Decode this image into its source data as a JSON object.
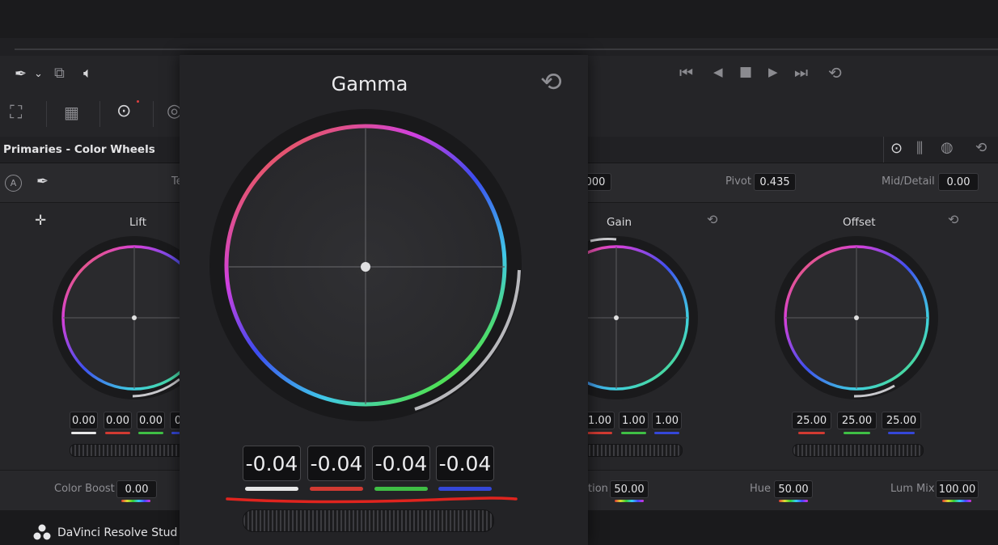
{
  "app": {
    "name": "DaVinci Resolve Stud"
  },
  "panel": {
    "title": "Primaries - Color Wheels"
  },
  "subrow": {
    "temp_label_partial": "Te",
    "contrast_partial": "000",
    "pivot_label": "Pivot",
    "pivot_value": "0.435",
    "middetail_label": "Mid/Detail",
    "middetail_value": "0.00"
  },
  "wheels": {
    "lift": {
      "label": "Lift",
      "values": [
        "0.00",
        "0.00",
        "0.00",
        "0"
      ]
    },
    "gain": {
      "label": "Gain",
      "values": [
        "1.00",
        "1.00",
        "1.00"
      ]
    },
    "offset": {
      "label": "Offset",
      "values": [
        "25.00",
        "25.00",
        "25.00"
      ]
    }
  },
  "bottom": {
    "color_boost_label": "Color Boost",
    "color_boost_value": "0.00",
    "saturation_label_partial": "tion",
    "saturation_value": "50.00",
    "hue_label": "Hue",
    "hue_value": "50.00",
    "lum_mix_label": "Lum Mix",
    "lum_mix_value": "100.00"
  },
  "gamma": {
    "title": "Gamma",
    "values": [
      "-0.04",
      "-0.04",
      "-0.04",
      "-0.04"
    ]
  },
  "colors": {
    "white": "#e8e8e8",
    "red": "#d13a32",
    "green": "#3fbf45",
    "blue": "#3447d8",
    "annotation": "#e0241e"
  },
  "icons": [
    "eyedropper-icon",
    "chevron-down-icon",
    "layers-icon",
    "speaker-icon",
    "skip-start-icon",
    "step-back-icon",
    "stop-icon",
    "play-icon",
    "skip-end-icon",
    "loop-icon",
    "reset-icon"
  ]
}
